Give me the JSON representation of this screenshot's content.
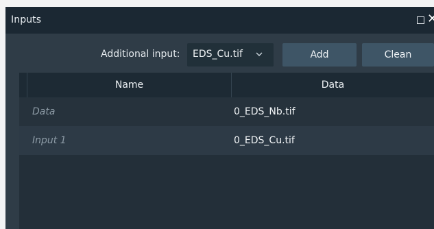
{
  "window": {
    "title": "Inputs",
    "restore_icon": "restore-icon",
    "close_icon": "close-icon",
    "close_glyph": "✕"
  },
  "toolbar": {
    "additional_input_label": "Additional input:",
    "selected_input": "EDS_Cu.tif",
    "dropdown_icon": "chevron-down-icon",
    "add_label": "Add",
    "clean_label": "Clean"
  },
  "table": {
    "columns": [
      "Name",
      "Data"
    ],
    "rows": [
      {
        "name": "Data",
        "data": "0_EDS_Nb.tif"
      },
      {
        "name": "Input 1",
        "data": "0_EDS_Cu.tif"
      }
    ]
  },
  "colors": {
    "panel": "#2f3c47",
    "titlebar": "#1b2833",
    "button": "#3e5566",
    "select": "#213039",
    "table": "#232f39"
  }
}
